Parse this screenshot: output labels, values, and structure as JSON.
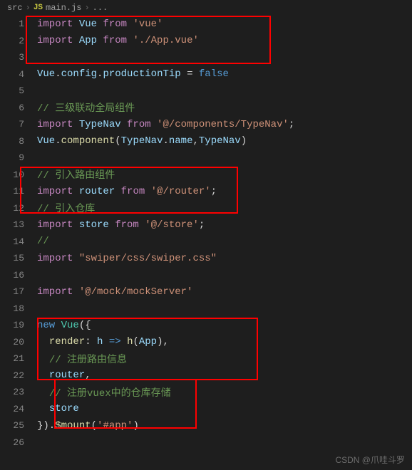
{
  "breadcrumb": {
    "folder": "src",
    "icon": "JS",
    "file": "main.js",
    "more": "..."
  },
  "lines": [
    {
      "n": "1",
      "tokens": [
        {
          "t": "import ",
          "c": "kw"
        },
        {
          "t": "Vue",
          "c": "var"
        },
        {
          "t": " from ",
          "c": "kw"
        },
        {
          "t": "'vue'",
          "c": "str"
        }
      ]
    },
    {
      "n": "2",
      "tokens": [
        {
          "t": "import ",
          "c": "kw"
        },
        {
          "t": "App",
          "c": "var"
        },
        {
          "t": " from ",
          "c": "kw"
        },
        {
          "t": "'./App.vue'",
          "c": "str"
        }
      ]
    },
    {
      "n": "3",
      "tokens": []
    },
    {
      "n": "4",
      "tokens": [
        {
          "t": "Vue",
          "c": "var"
        },
        {
          "t": ".",
          "c": "pun"
        },
        {
          "t": "config",
          "c": "prop"
        },
        {
          "t": ".",
          "c": "pun"
        },
        {
          "t": "productionTip",
          "c": "prop"
        },
        {
          "t": " = ",
          "c": "op"
        },
        {
          "t": "false",
          "c": "const"
        }
      ]
    },
    {
      "n": "5",
      "tokens": []
    },
    {
      "n": "6",
      "tokens": [
        {
          "t": "// 三级联动全局组件",
          "c": "comment"
        }
      ]
    },
    {
      "n": "7",
      "tokens": [
        {
          "t": "import ",
          "c": "kw"
        },
        {
          "t": "TypeNav",
          "c": "var"
        },
        {
          "t": " from ",
          "c": "kw"
        },
        {
          "t": "'@/components/TypeNav'",
          "c": "str"
        },
        {
          "t": ";",
          "c": "pun"
        }
      ]
    },
    {
      "n": "8",
      "tokens": [
        {
          "t": "Vue",
          "c": "var"
        },
        {
          "t": ".",
          "c": "pun"
        },
        {
          "t": "component",
          "c": "fn"
        },
        {
          "t": "(",
          "c": "pun"
        },
        {
          "t": "TypeNav",
          "c": "var"
        },
        {
          "t": ".",
          "c": "pun"
        },
        {
          "t": "name",
          "c": "prop"
        },
        {
          "t": ",",
          "c": "pun"
        },
        {
          "t": "TypeNav",
          "c": "var"
        },
        {
          "t": ")",
          "c": "pun"
        }
      ]
    },
    {
      "n": "9",
      "tokens": []
    },
    {
      "n": "10",
      "tokens": [
        {
          "t": "// 引入路由组件",
          "c": "comment"
        }
      ]
    },
    {
      "n": "11",
      "tokens": [
        {
          "t": "import ",
          "c": "kw"
        },
        {
          "t": "router",
          "c": "var"
        },
        {
          "t": " from ",
          "c": "kw"
        },
        {
          "t": "'@/router'",
          "c": "str"
        },
        {
          "t": ";",
          "c": "pun"
        }
      ]
    },
    {
      "n": "12",
      "tokens": [
        {
          "t": "// 引入仓库",
          "c": "comment"
        }
      ]
    },
    {
      "n": "13",
      "tokens": [
        {
          "t": "import ",
          "c": "kw"
        },
        {
          "t": "store",
          "c": "var"
        },
        {
          "t": " from ",
          "c": "kw"
        },
        {
          "t": "'@/store'",
          "c": "str"
        },
        {
          "t": ";",
          "c": "pun"
        }
      ]
    },
    {
      "n": "14",
      "tokens": [
        {
          "t": "//",
          "c": "comment"
        }
      ]
    },
    {
      "n": "15",
      "tokens": [
        {
          "t": "import ",
          "c": "kw"
        },
        {
          "t": "\"swiper/css/swiper.css\"",
          "c": "str"
        }
      ]
    },
    {
      "n": "16",
      "tokens": []
    },
    {
      "n": "17",
      "tokens": [
        {
          "t": "import ",
          "c": "kw"
        },
        {
          "t": "'@/mock/mockServer'",
          "c": "str"
        }
      ]
    },
    {
      "n": "18",
      "tokens": []
    },
    {
      "n": "19",
      "tokens": [
        {
          "t": "new ",
          "c": "const"
        },
        {
          "t": "Vue",
          "c": "cls"
        },
        {
          "t": "({",
          "c": "pun"
        }
      ]
    },
    {
      "n": "20",
      "tokens": [
        {
          "t": "  ",
          "c": "pun"
        },
        {
          "t": "render",
          "c": "fn"
        },
        {
          "t": ": ",
          "c": "pun"
        },
        {
          "t": "h",
          "c": "var"
        },
        {
          "t": " => ",
          "c": "const"
        },
        {
          "t": "h",
          "c": "fn"
        },
        {
          "t": "(",
          "c": "pun"
        },
        {
          "t": "App",
          "c": "var"
        },
        {
          "t": "),",
          "c": "pun"
        }
      ]
    },
    {
      "n": "21",
      "tokens": [
        {
          "t": "  ",
          "c": "pun"
        },
        {
          "t": "// 注册路由信息",
          "c": "comment"
        }
      ]
    },
    {
      "n": "22",
      "tokens": [
        {
          "t": "  ",
          "c": "pun"
        },
        {
          "t": "router",
          "c": "var"
        },
        {
          "t": ",",
          "c": "pun"
        }
      ]
    },
    {
      "n": "23",
      "tokens": [
        {
          "t": "  ",
          "c": "pun"
        },
        {
          "t": "// 注册vuex中的仓库存储",
          "c": "comment"
        }
      ]
    },
    {
      "n": "24",
      "tokens": [
        {
          "t": "  ",
          "c": "pun"
        },
        {
          "t": "store",
          "c": "var"
        }
      ]
    },
    {
      "n": "25",
      "tokens": [
        {
          "t": "}).",
          "c": "pun"
        },
        {
          "t": "$mount",
          "c": "fn"
        },
        {
          "t": "(",
          "c": "pun"
        },
        {
          "t": "'#app'",
          "c": "str"
        },
        {
          "t": ")",
          "c": "pun"
        }
      ]
    },
    {
      "n": "26",
      "tokens": []
    }
  ],
  "watermark": "CSDN @爪哇斗罗"
}
